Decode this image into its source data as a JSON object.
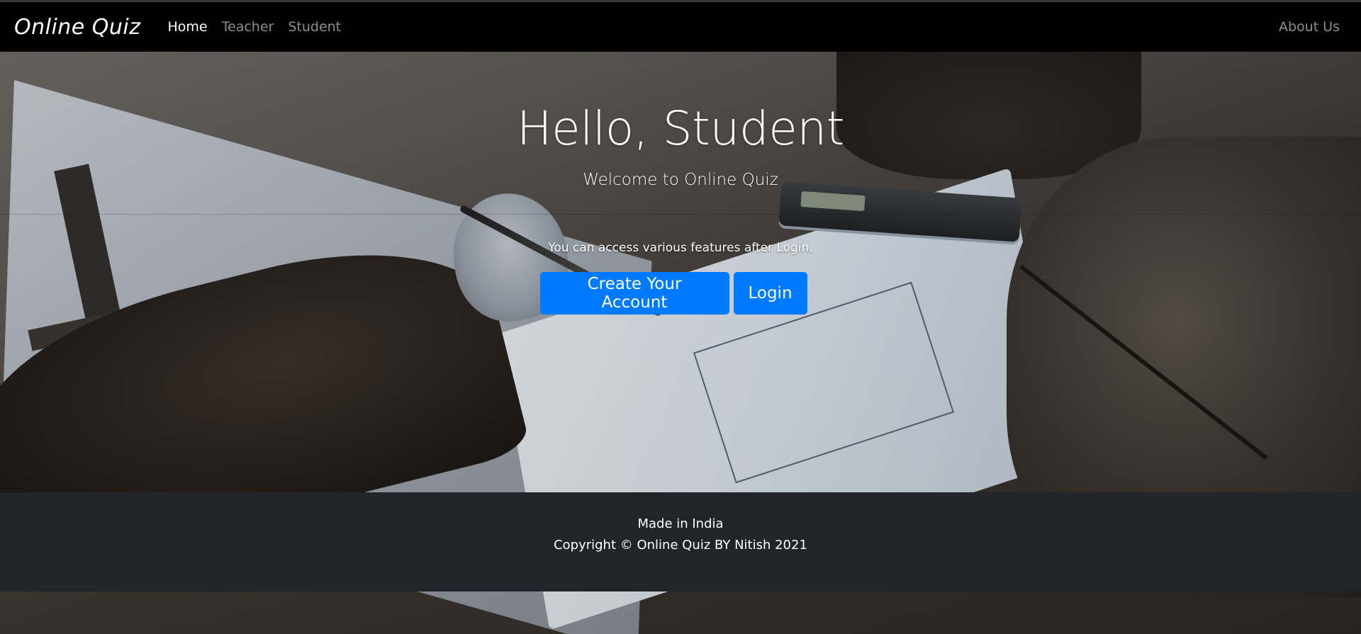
{
  "navbar": {
    "brand": "Online Quiz",
    "links": [
      {
        "label": "Home",
        "active": true
      },
      {
        "label": "Teacher",
        "active": false
      },
      {
        "label": "Student",
        "active": false
      }
    ],
    "right_link": "About Us"
  },
  "hero": {
    "title": "Hello, Student",
    "subtitle": "Welcome to Online Quiz",
    "lead": "You can access various features after Login.",
    "buttons": {
      "create": "Create Your Account",
      "login": "Login"
    }
  },
  "footer": {
    "line1": "Made in India",
    "line2": "Copyright © Online Quiz BY Nitish 2021"
  },
  "colors": {
    "navbar_bg": "#000000",
    "primary_button": "#007bff",
    "footer_bg": "#212529"
  }
}
